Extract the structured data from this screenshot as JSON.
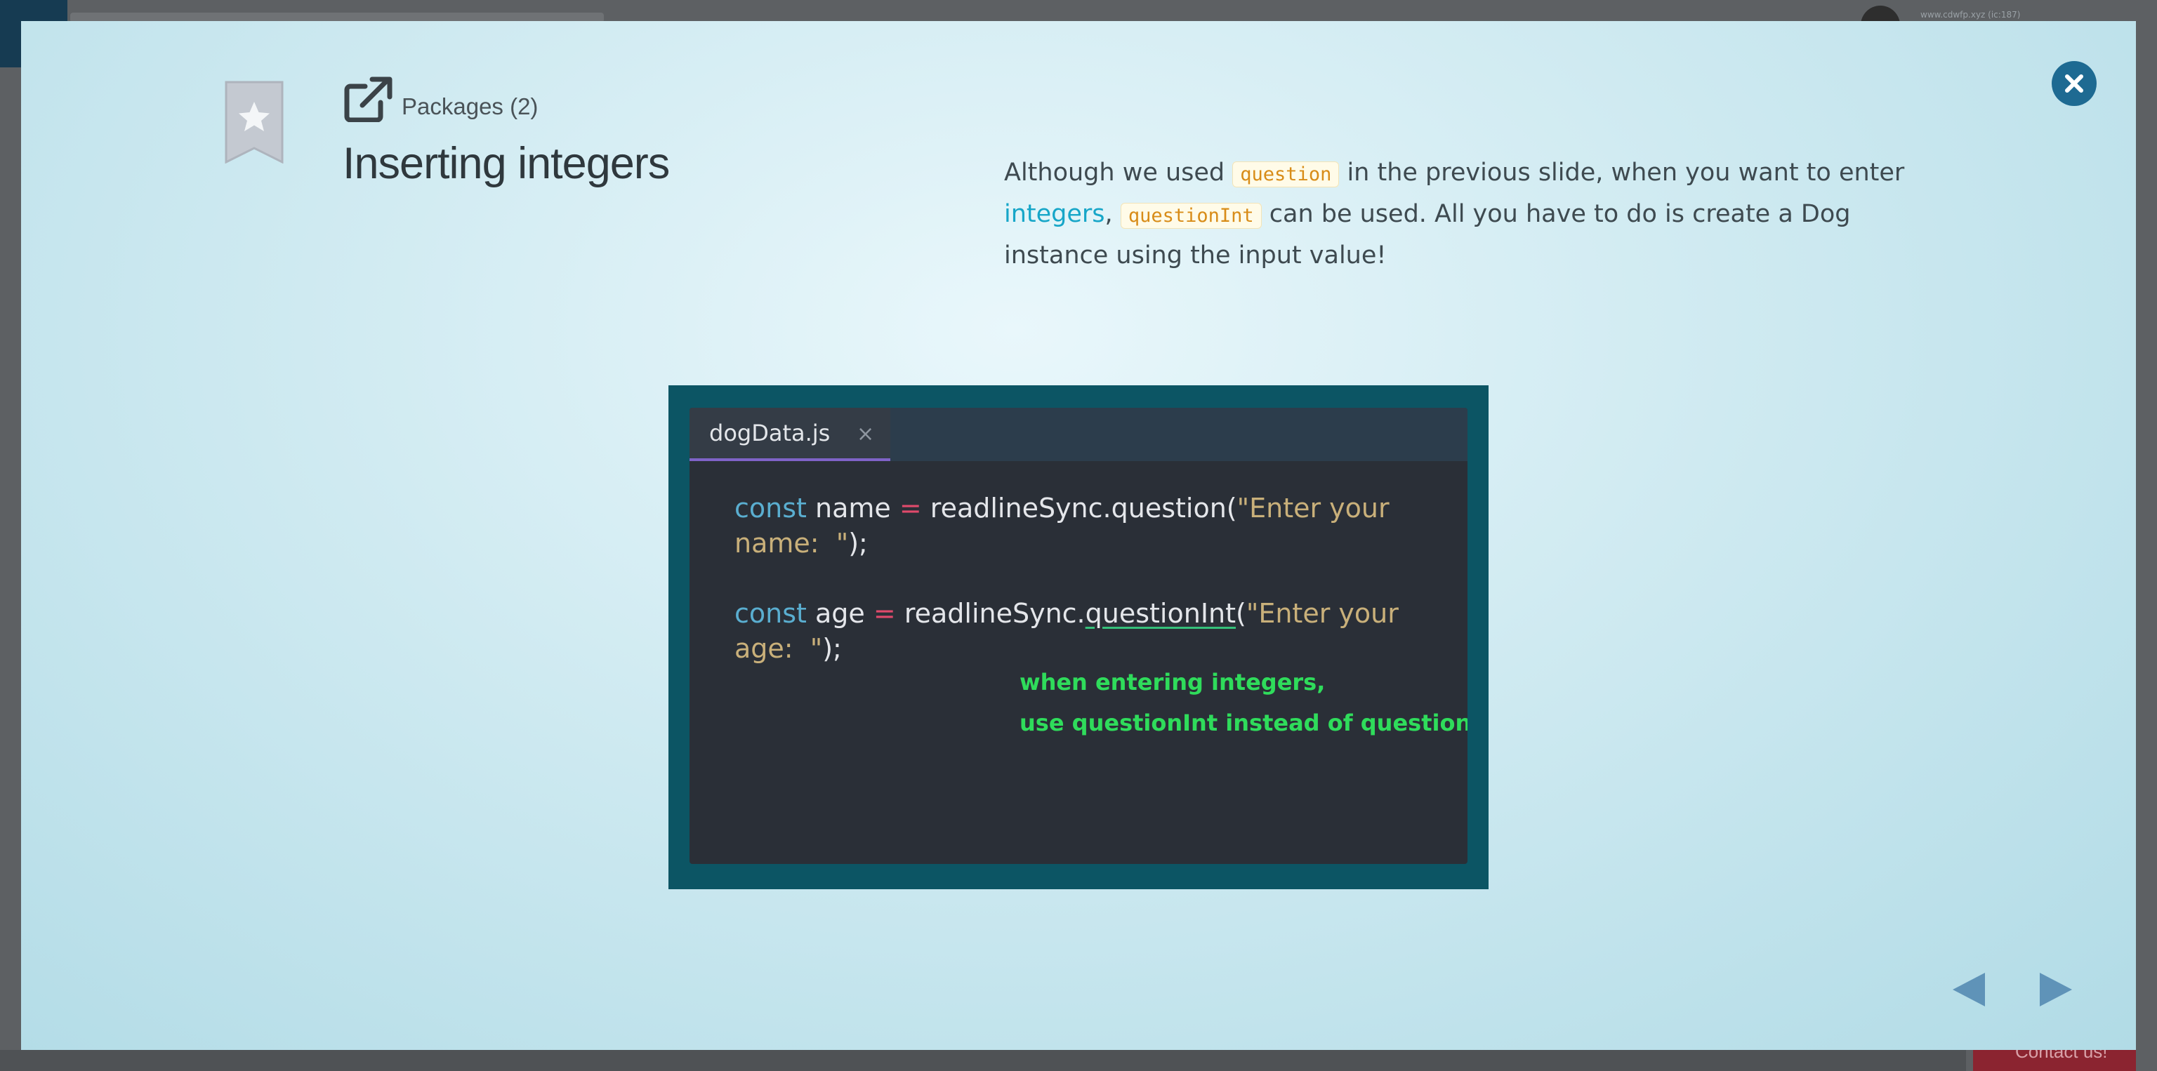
{
  "background": {
    "url_text": "www.cdwfp.xyz (ic:187)",
    "contact_label": "Contact us!"
  },
  "modal": {
    "package_link": "Packages (2)",
    "title": "Inserting integers",
    "description": {
      "t1": "Although we used ",
      "code1": "question",
      "t2": " in the previous slide, when you want to enter ",
      "link": "integers",
      "t3": ", ",
      "code2": "questionInt",
      "t4": " can be used. All you have to do is create a Dog instance using the input value!"
    },
    "code_image": {
      "tab_name": "dogData.js",
      "tab_close": "×",
      "line1": {
        "kw": "const",
        "name": " name ",
        "op": "=",
        "call": " readlineSync.question(",
        "str": "\"Enter your"
      },
      "line1b": {
        "str": "name:  \"",
        "end": ");"
      },
      "line2": {
        "kw": "const",
        "name": " age ",
        "op": "=",
        "obj": " readlineSync.",
        "method": "questionInt",
        "paren": "(",
        "str": "\"Enter your"
      },
      "line2b": {
        "str": "age:  \"",
        "end": ");"
      },
      "annotation_1": "when entering integers,",
      "annotation_2": "use questionInt instead of question"
    }
  },
  "colors": {
    "modal_bg": "#cfeaf1",
    "accent_blue": "#1e6a92",
    "code_tag": "#d88c18",
    "link": "#17a6c8",
    "annotation_green": "#2fdc5b"
  },
  "icons": [
    "star-bookmark-icon",
    "external-link-icon",
    "close-icon",
    "chevron-left-icon",
    "chevron-right-icon"
  ]
}
